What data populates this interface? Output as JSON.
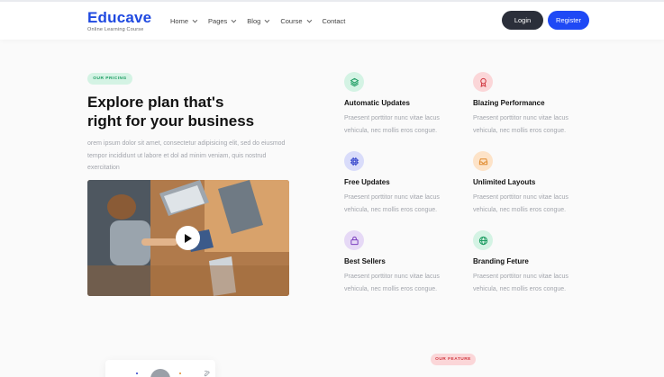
{
  "brand": {
    "name": "Educave",
    "tagline": "Online Learning Course"
  },
  "nav": [
    {
      "label": "Home",
      "dropdown": true
    },
    {
      "label": "Pages",
      "dropdown": true
    },
    {
      "label": "Blog",
      "dropdown": true
    },
    {
      "label": "Course",
      "dropdown": true
    },
    {
      "label": "Contact",
      "dropdown": false
    }
  ],
  "auth": {
    "login": "Login",
    "register": "Register"
  },
  "pricing": {
    "badge": "OUR PRICING",
    "headline_line1": "Explore plan that's",
    "headline_line2": "right for your business",
    "lead": "orem ipsum dolor sit amet, consectetur adipisicing elit, sed do eiusmod tempor incididunt ut labore et dol ad minim veniam, quis nostrud exercitation"
  },
  "video": {
    "play_icon": "play-icon"
  },
  "features": [
    {
      "title": "Automatic Updates",
      "desc": "Praesent porttitor nunc vitae lacus vehicula, nec mollis eros congue.",
      "icon": "layers-icon",
      "color": "#1c9c61",
      "bg": "#d4f3e4"
    },
    {
      "title": "Blazing Performance",
      "desc": "Praesent porttitor nunc vitae lacus vehicula, nec mollis eros congue.",
      "icon": "badge-icon",
      "color": "#d0363f",
      "bg": "#fbd6d8"
    },
    {
      "title": "Free Updates",
      "desc": "Praesent porttitor nunc vitae lacus vehicula, nec mollis eros congue.",
      "icon": "chip-icon",
      "color": "#2d3ec9",
      "bg": "#d9dcfa"
    },
    {
      "title": "Unlimited Layouts",
      "desc": "Praesent porttitor nunc vitae lacus vehicula, nec mollis eros congue.",
      "icon": "inbox-icon",
      "color": "#e08a2c",
      "bg": "#fde3c8"
    },
    {
      "title": "Best Sellers",
      "desc": "Praesent porttitor nunc vitae lacus vehicula, nec mollis eros congue.",
      "icon": "lock-icon",
      "color": "#7b3fbf",
      "bg": "#e6d9f6"
    },
    {
      "title": "Branding Feture",
      "desc": "Praesent porttitor nunc vitae lacus vehicula, nec mollis eros congue.",
      "icon": "globe-icon",
      "color": "#1c9c61",
      "bg": "#d4f3e4"
    }
  ],
  "feature_section": {
    "badge": "OUR FEATURE"
  },
  "colors": {
    "brand": "#1f49e0",
    "register": "#1f49f5",
    "login": "#2b2f3a"
  }
}
